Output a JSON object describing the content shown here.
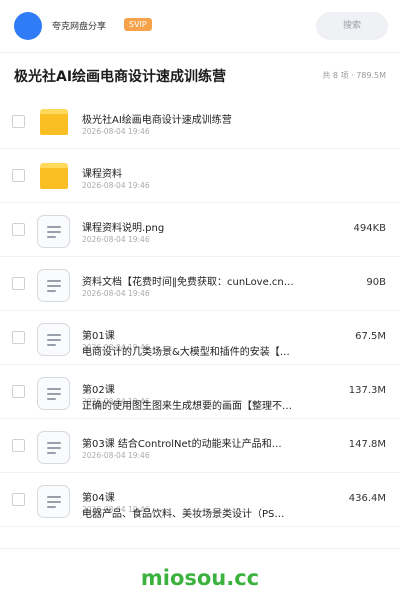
{
  "header": {
    "username": "夸克网盘分享",
    "badge": "SVIP",
    "search_label": "搜索"
  },
  "folder": {
    "title": "极光社AI绘画电商设计速成训练营",
    "summary": "共 8 项 · 789.5M"
  },
  "items": [
    {
      "type": "folder",
      "name": "极光社AI绘画电商设计速成训练营",
      "name_line2": "",
      "date": "2026-08-04 19:46",
      "size": ""
    },
    {
      "type": "folder",
      "name": "课程资料",
      "name_line2": "",
      "date": "2026-08-04 19:46",
      "size": ""
    },
    {
      "type": "file",
      "name": "课程资料说明.png",
      "name_line2": "",
      "date": "2026-08-04 19:46",
      "size": "494KB"
    },
    {
      "type": "file",
      "name": "资料文档【花费时间‖免费获取：cunLove.cn…",
      "name_line2": "",
      "date": "2026-08-04 19:46",
      "size": "90B"
    },
    {
      "type": "file",
      "name": "第01课",
      "name_line2": "电商设计的几类场景&大模型和插件的安装【…",
      "date": "2026-08-04 19:46",
      "size": "67.5M"
    },
    {
      "type": "file",
      "name": "第02课",
      "name_line2": "正确的使用图生图来生成想要的画面【整理不…",
      "date": "2026-08-04 19:46",
      "size": "137.3M"
    },
    {
      "type": "file",
      "name": "第03课 结合ControlNet的动能来让产品和…",
      "name_line2": "",
      "date": "2026-08-04 19:46",
      "size": "147.8M"
    },
    {
      "type": "file",
      "name": "第04课",
      "name_line2": "电器产品、食品饮料、美妆场景类设计（PS…",
      "date": "2026-08-04 19:46",
      "size": "436.4M"
    }
  ],
  "watermark": "miosou.cc",
  "colors": {
    "accent": "#2f7cf6",
    "svip": "#f5a24a",
    "folder": "#fbbe23",
    "watermark": "#3cb23e"
  }
}
